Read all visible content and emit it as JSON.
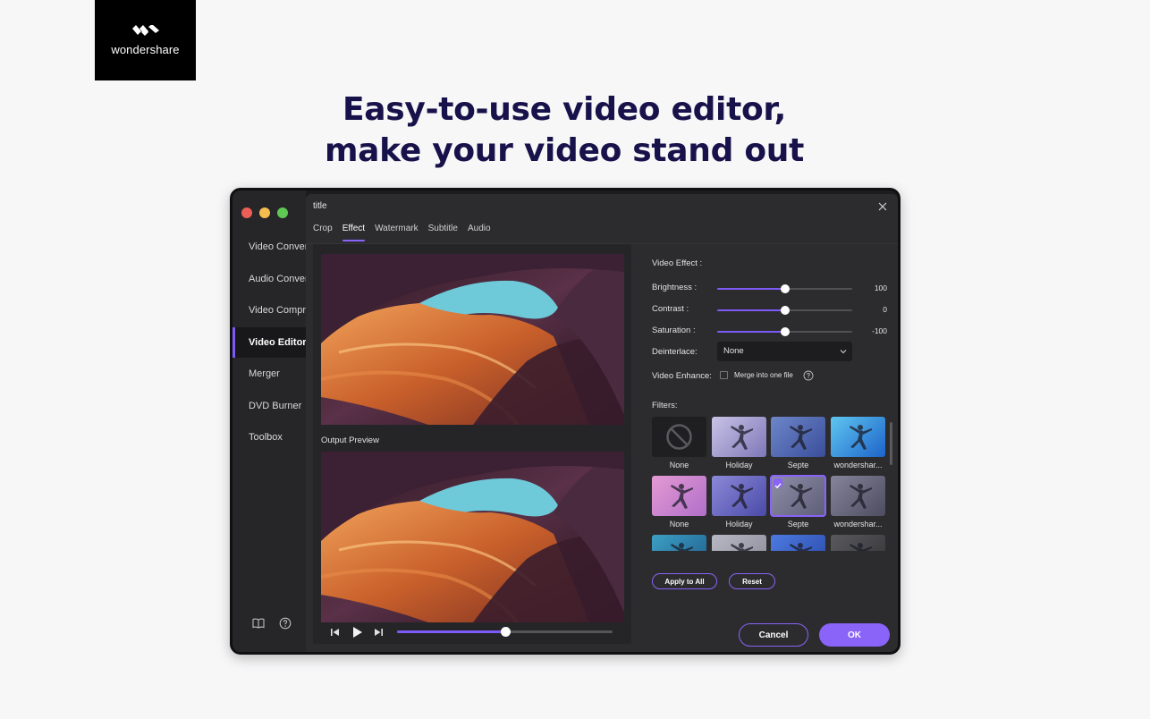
{
  "brand": {
    "name": "wondershare"
  },
  "headline": {
    "line1": "Easy-to-use video editor,",
    "line2": "make your video stand out"
  },
  "sidebar": {
    "items": [
      {
        "label": "Video Converter",
        "active": false
      },
      {
        "label": "Audio Converter",
        "active": false
      },
      {
        "label": "Video Compressor",
        "active": false
      },
      {
        "label": "Video Editor",
        "active": true
      },
      {
        "label": "Merger",
        "active": false
      },
      {
        "label": "DVD Burner",
        "active": false
      },
      {
        "label": "Toolbox",
        "active": false
      }
    ],
    "bottom_icons": [
      "book-icon",
      "help-icon"
    ]
  },
  "dialog": {
    "title": "title",
    "tabs": [
      {
        "label": "Crop",
        "active": false
      },
      {
        "label": "Effect",
        "active": true
      },
      {
        "label": "Watermark",
        "active": false
      },
      {
        "label": "Subtitle",
        "active": false
      },
      {
        "label": "Audio",
        "active": false
      }
    ],
    "output_preview_label": "Output Preview",
    "player": {
      "progress": 0.5
    }
  },
  "effect": {
    "section_label": "Video Effect :",
    "sliders": [
      {
        "label": "Brightness :",
        "value": "100",
        "position": 0.5
      },
      {
        "label": "Contrast :",
        "value": "0",
        "position": 0.5
      },
      {
        "label": "Saturation :",
        "value": "-100",
        "position": 0.5
      }
    ],
    "deinterlace": {
      "label": "Deinterlace:",
      "value": "None"
    },
    "enhance": {
      "label": "Video Enhance:",
      "checkbox_label": "Merge into one file",
      "checked": false
    },
    "filters_label": "Filters:",
    "filters": [
      {
        "name": "None",
        "style": "none"
      },
      {
        "name": "Holiday",
        "style": "holiday"
      },
      {
        "name": "Septe",
        "style": "septe"
      },
      {
        "name": "wondershar...",
        "style": "wonder"
      },
      {
        "name": "None",
        "style": "pink"
      },
      {
        "name": "Holiday",
        "style": "holiday2"
      },
      {
        "name": "Septe",
        "style": "septe2",
        "selected": true
      },
      {
        "name": "wondershar...",
        "style": "dark"
      },
      {
        "name": "",
        "style": "teal"
      },
      {
        "name": "",
        "style": "grey"
      },
      {
        "name": "",
        "style": "blue"
      },
      {
        "name": "",
        "style": "darkgrey"
      }
    ],
    "apply_all_label": "Apply to All",
    "reset_label": "Reset"
  },
  "footer": {
    "cancel_label": "Cancel",
    "ok_label": "OK"
  },
  "colors": {
    "accent": "#8a63f8",
    "headline": "#17124a",
    "window_bg": "#2c2c2e"
  }
}
